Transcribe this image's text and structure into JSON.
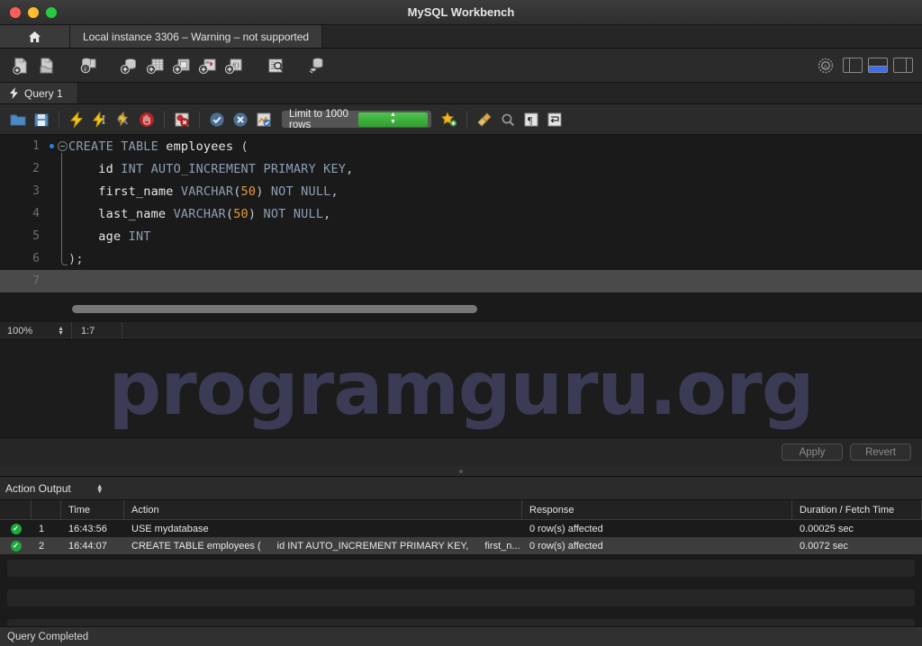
{
  "window": {
    "title": "MySQL Workbench",
    "traffic_lights": [
      "close-red",
      "minimize-yellow",
      "zoom-green"
    ]
  },
  "instance_tabs": {
    "home_icon": "home-icon",
    "active_tab": "Local instance 3306 – Warning – not supported"
  },
  "main_toolbar": {
    "buttons": [
      {
        "name": "new-sql-file",
        "icon": "new-sql-file-icon"
      },
      {
        "name": "open-sql-file",
        "icon": "open-sql-file-icon"
      },
      {
        "name": "schema-inspector",
        "icon": "schema-info-icon"
      },
      {
        "name": "create-schema",
        "icon": "add-schema-icon"
      },
      {
        "name": "create-table",
        "icon": "add-table-icon"
      },
      {
        "name": "create-view",
        "icon": "add-view-icon"
      },
      {
        "name": "create-procedure",
        "icon": "add-procedure-icon"
      },
      {
        "name": "create-function",
        "icon": "add-function-icon"
      },
      {
        "name": "search-data",
        "icon": "search-table-data-icon"
      },
      {
        "name": "reconnect-server",
        "icon": "reconnect-dbms-icon"
      }
    ],
    "right_buttons": [
      {
        "name": "admin-settings",
        "icon": "gear-badge-icon"
      },
      {
        "name": "toggle-sidebar",
        "icon": "panel-left-icon",
        "active": false
      },
      {
        "name": "toggle-output",
        "icon": "panel-bottom-icon",
        "active": true
      },
      {
        "name": "toggle-secondary-sidebar",
        "icon": "panel-right-icon",
        "active": false
      }
    ]
  },
  "query_tab": {
    "icon": "lightning-icon",
    "label": "Query 1"
  },
  "sql_toolbar": {
    "buttons": [
      {
        "name": "open-script",
        "icon": "folder-icon"
      },
      {
        "name": "save-script",
        "icon": "floppy-disk-icon"
      },
      {
        "name": "execute-statement",
        "icon": "execute-lightning-icon"
      },
      {
        "name": "execute-current-statement",
        "icon": "execute-cursor-icon"
      },
      {
        "name": "explain-statement",
        "icon": "explain-magnifier-icon"
      },
      {
        "name": "stop-execution",
        "icon": "stop-hand-icon"
      },
      {
        "name": "toggle-stop-on-error",
        "icon": "stop-on-error-icon"
      },
      {
        "name": "commit-transaction",
        "icon": "commit-check-icon"
      },
      {
        "name": "rollback-transaction",
        "icon": "rollback-cross-icon"
      },
      {
        "name": "toggle-auto-commit",
        "icon": "auto-commit-icon"
      },
      {
        "name": "beautify-sql",
        "icon": "beautify-star-icon"
      },
      {
        "name": "toggle-find",
        "icon": "find-brush-icon"
      },
      {
        "name": "search-snippets",
        "icon": "magnifier-icon"
      },
      {
        "name": "toggle-invisible-chars",
        "icon": "pilcrow-icon"
      },
      {
        "name": "wrap-lines",
        "icon": "wrap-lines-icon"
      }
    ],
    "row_limit": {
      "label": "Limit to 1000 rows",
      "stepper": "stepper-up-down"
    }
  },
  "editor": {
    "lines": [
      {
        "number": "1",
        "has_breakpoint_dot": true,
        "fold": "open",
        "tokens": [
          {
            "t": "CREATE TABLE ",
            "c": "kw"
          },
          {
            "t": "employees ",
            "c": "id"
          },
          {
            "t": "(",
            "c": "punc"
          }
        ]
      },
      {
        "number": "2",
        "tokens": [
          {
            "t": "    id ",
            "c": "id"
          },
          {
            "t": "INT AUTO_INCREMENT PRIMARY KEY",
            "c": "kw"
          },
          {
            "t": ",",
            "c": "punc"
          }
        ]
      },
      {
        "number": "3",
        "tokens": [
          {
            "t": "    first_name ",
            "c": "id"
          },
          {
            "t": "VARCHAR",
            "c": "kw"
          },
          {
            "t": "(",
            "c": "punc"
          },
          {
            "t": "50",
            "c": "num"
          },
          {
            "t": ") ",
            "c": "punc"
          },
          {
            "t": "NOT NULL",
            "c": "kw"
          },
          {
            "t": ",",
            "c": "punc"
          }
        ]
      },
      {
        "number": "4",
        "tokens": [
          {
            "t": "    last_name ",
            "c": "id"
          },
          {
            "t": "VARCHAR",
            "c": "kw"
          },
          {
            "t": "(",
            "c": "punc"
          },
          {
            "t": "50",
            "c": "num"
          },
          {
            "t": ") ",
            "c": "punc"
          },
          {
            "t": "NOT NULL",
            "c": "kw"
          },
          {
            "t": ",",
            "c": "punc"
          }
        ]
      },
      {
        "number": "5",
        "tokens": [
          {
            "t": "    age ",
            "c": "id"
          },
          {
            "t": "INT",
            "c": "kw"
          }
        ]
      },
      {
        "number": "6",
        "fold": "end",
        "tokens": [
          {
            "t": ");",
            "c": "punc"
          }
        ]
      },
      {
        "number": "7",
        "current": true,
        "tokens": []
      }
    ]
  },
  "editor_status": {
    "zoom": "100%",
    "cursor_position": "1:7"
  },
  "watermark": {
    "text": "programguru.org",
    "color": "#3c3b55"
  },
  "apply_bar": {
    "apply_label": "Apply",
    "revert_label": "Revert"
  },
  "action_output": {
    "title": "Action Output",
    "selector_icon": "stepper-up-down",
    "columns": [
      "",
      "",
      "Time",
      "Action",
      "Response",
      "Duration / Fetch Time"
    ],
    "rows": [
      {
        "status": "success",
        "num": "1",
        "time": "16:43:56",
        "action": "USE mydatabase",
        "action_extra": "",
        "action_extra2": "",
        "response": "0 row(s) affected",
        "duration": "0.00025 sec",
        "selected": false
      },
      {
        "status": "success",
        "num": "2",
        "time": "16:44:07",
        "action": "CREATE TABLE employees (",
        "action_extra": "id INT AUTO_INCREMENT PRIMARY KEY,",
        "action_extra2": "first_n...",
        "response": "0 row(s) affected",
        "duration": "0.0072 sec",
        "selected": true
      }
    ]
  },
  "status_bar": {
    "message": "Query Completed"
  }
}
